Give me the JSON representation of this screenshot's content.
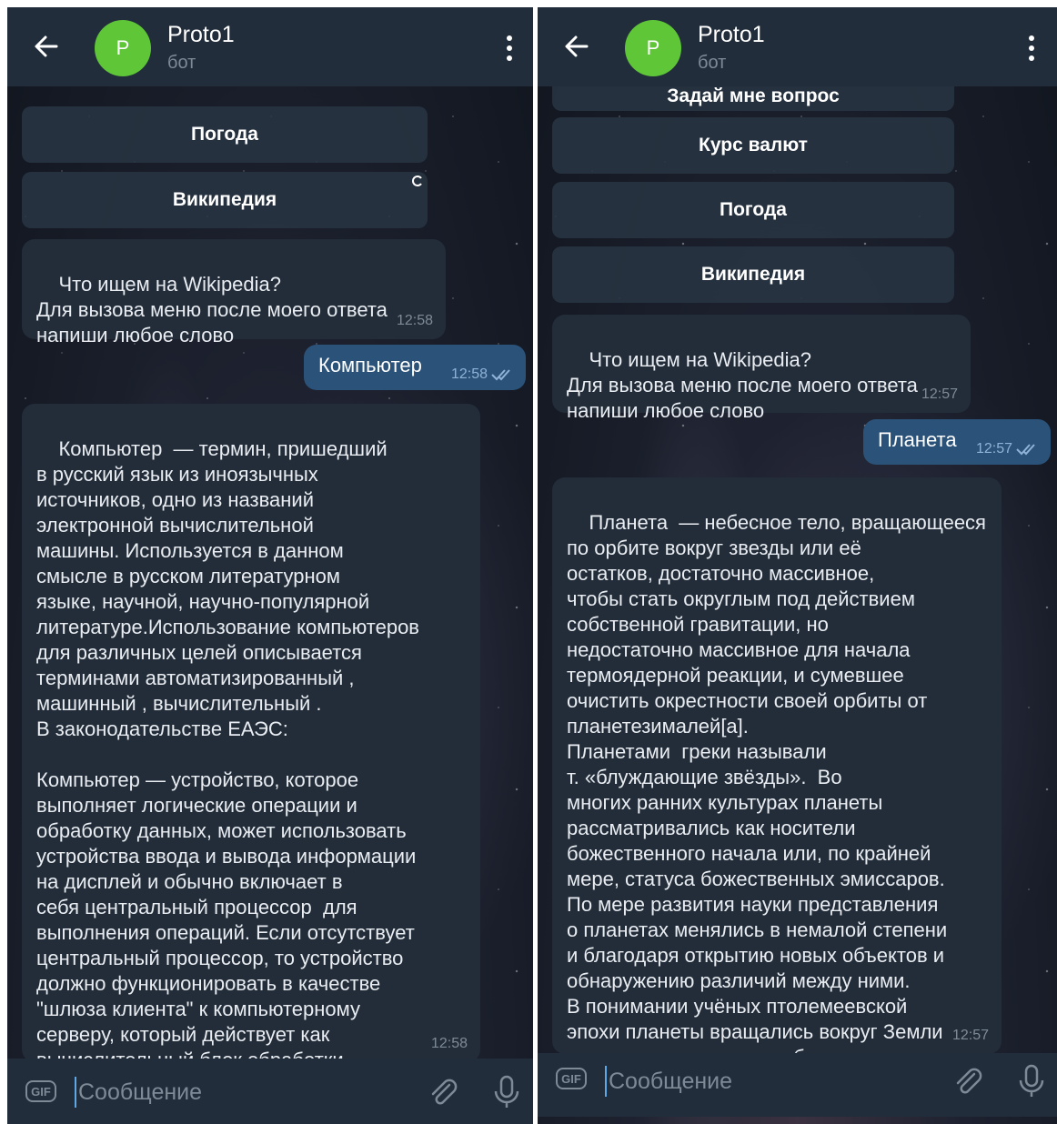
{
  "chat": {
    "title": "Proto1",
    "subtitle": "бот",
    "avatar_letter": "P"
  },
  "input": {
    "placeholder": "Сообщение",
    "gif_label": "GIF"
  },
  "left": {
    "partial_button": "",
    "keyboard": [
      "Погода",
      "Википедия"
    ],
    "bot_prompt": {
      "text": "Что ищем на Wikipedia?\nДля вызова меню после моего ответа\nнапиши любое слово",
      "time": "12:58"
    },
    "user_message": {
      "text": "Компьютер",
      "time": "12:58"
    },
    "bot_answer": {
      "text": "Компьютер  — термин, пришедший\nв русский язык из иноязычных\nисточников, одно из названий\nэлектронной вычислительной\nмашины. Используется в данном\nсмысле в русском литературном\nязыке, научной, научно-популярной\nлитературе.Использование компьютеров\nдля различных целей описывается\nтерминами автоматизированный ,\nмашинный , вычислительный .\nВ законодательстве ЕАЭС:\n\nКомпьютер — устройство, которое\nвыполняет логические операции и\nобработку данных, может использовать\nустройства ввода и вывода информации\nна дисплей и обычно включает в\nсебя центральный процессор  для\nвыполнения операций. Если отсутствует\nцентральный процессор, то устройство\nдолжно функционировать в качестве\n\"шлюза клиента\" к компьютерному\nсерверу, который действует как\nвычислительный блок обработки.",
      "time": "12:58"
    }
  },
  "right": {
    "partial_button": "Задай мне вопрос",
    "keyboard": [
      "Курс валют",
      "Погода",
      "Википедия"
    ],
    "bot_prompt": {
      "text": "Что ищем на Wikipedia?\nДля вызова меню после моего ответа\nнапиши любое слово",
      "time": "12:57"
    },
    "user_message": {
      "text": "Планета",
      "time": "12:57"
    },
    "bot_answer": {
      "text": "Планета  — небесное тело, вращающееся\nпо орбите вокруг звезды или её\nостатков, достаточно массивное,\nчтобы стать округлым под действием\nсобственной гравитации, но\nнедостаточно массивное для начала\nтермоядерной реакции, и сумевшее\nочистить окрестности своей орбиты от\nпланетезималей[a].\nПланетами  греки называли\nт. «блуждающие звёзды».  Во\nмногих ранних культурах планеты\nрассматривались как носители\nбожественного начала или, по крайней\nмере, статуса божественных эмиссаров.\nПо мере развития науки представления\nо планетах менялись в немалой степени\nи благодаря открытию новых объектов и\nобнаружению различий между ними.\nВ понимании учёных птолемеевской\nэпохи планеты вращались вокруг Земли\nпо идеально круглым орбитам.",
      "time": "12:57"
    }
  },
  "colors": {
    "header": "#212d3b",
    "bubble_in": "#222d39",
    "bubble_out": "#2b5278",
    "avatar": "#5fc638",
    "accent": "#5fa8e8"
  },
  "icons": [
    "arrow-left",
    "more-vertical",
    "double-check",
    "paperclip",
    "microphone",
    "gif"
  ]
}
